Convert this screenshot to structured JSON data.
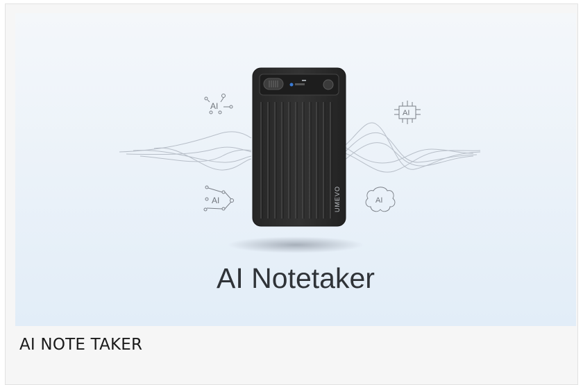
{
  "product": {
    "hero_title": "AI Notetaker",
    "brand": "UMEVO",
    "caption": "AI NOTE TAKER"
  },
  "icons": {
    "ai_chat": "AI",
    "ai_circuit": "AI",
    "ai_network": "AI",
    "ai_brain": "AI"
  },
  "colors": {
    "device": "#2b2b2b",
    "hero_bg_top": "#f4f7fa",
    "hero_bg_bottom": "#e2edf8",
    "title_text": "#2f3338"
  }
}
